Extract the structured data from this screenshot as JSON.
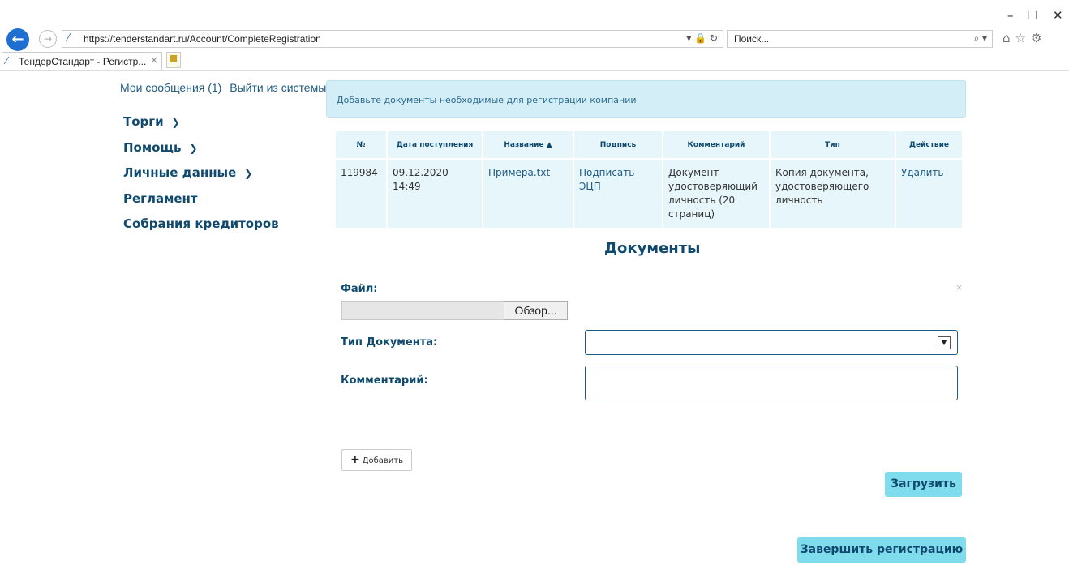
{
  "browser": {
    "url": "https://tenderstandart.ru/Account/CompleteRegistration",
    "search_placeholder": "Поиск...",
    "tab_title": "ТендерСтандарт - Регистр..."
  },
  "sidebar": {
    "messages": "Мои сообщения (1)",
    "logout": "Выйти из системы",
    "items": [
      {
        "label": "Торги",
        "has_dropdown": true
      },
      {
        "label": "Помощь",
        "has_dropdown": true
      },
      {
        "label": "Личные данные",
        "has_dropdown": true
      },
      {
        "label": "Регламент",
        "has_dropdown": false
      },
      {
        "label": "Собрания кредиторов",
        "has_dropdown": false
      }
    ]
  },
  "alert": {
    "text": "Добавьте документы необходимые для регистрации компании"
  },
  "table": {
    "headers": [
      "№",
      "Дата поступления",
      "Название ▲",
      "Подпись",
      "Комментарий",
      "Тип",
      "Действие"
    ],
    "rows": [
      {
        "num": "119984",
        "date": "09.12.2020 14:49",
        "name": "Примера.txt",
        "sign": "Подписать ЭЦП",
        "comment": "Документ удостоверяющий личность (20 страниц)",
        "type": "Копия документа, удостоверяющего личность",
        "action": "Удалить"
      }
    ]
  },
  "section": {
    "title": "Документы",
    "file_label": "Файл:",
    "browse_label": "Обзор...",
    "doctype_label": "Тип Документа:",
    "comment_label": "Комментарий:",
    "close_glyph": "×"
  },
  "buttons": {
    "add": "Добавить",
    "upload": "Загрузить",
    "finish": "Завершить регистрацию"
  },
  "colors": {
    "accent": "#7fdcec",
    "heading": "#0f4a6e",
    "table_bg": "#e7f6fb"
  }
}
